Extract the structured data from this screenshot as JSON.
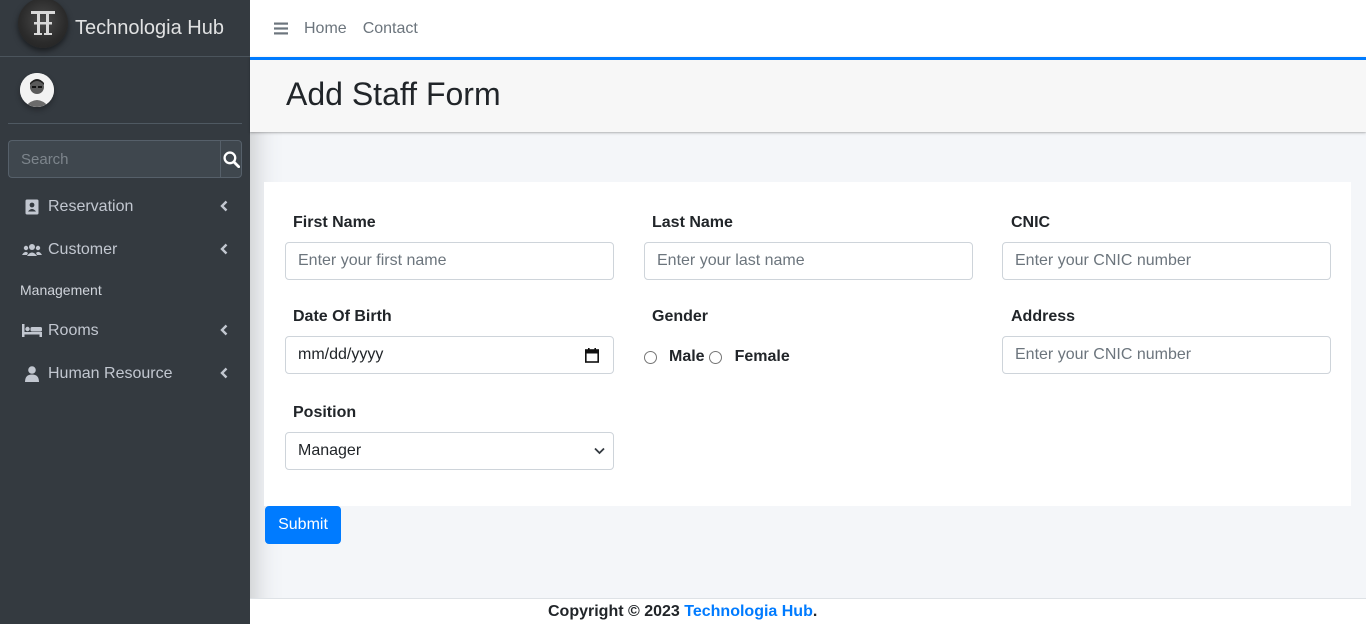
{
  "brand": {
    "name": "Technologia Hub",
    "logo_icon": "th-monogram-logo"
  },
  "user": {
    "avatar_icon": "user-avatar"
  },
  "sidebar": {
    "search_placeholder": "Search",
    "items": [
      {
        "label": "Reservation",
        "icon": "address-book-icon"
      },
      {
        "label": "Customer",
        "icon": "users-icon"
      }
    ],
    "header": "Management",
    "items2": [
      {
        "label": "Rooms",
        "icon": "bed-icon"
      },
      {
        "label": "Human Resource",
        "icon": "user-icon"
      }
    ]
  },
  "topbar": {
    "links": [
      "Home",
      "Contact"
    ]
  },
  "page": {
    "title": "Add Staff Form"
  },
  "form": {
    "first_name": {
      "label": "First Name",
      "placeholder": "Enter your first name"
    },
    "last_name": {
      "label": "Last Name",
      "placeholder": "Enter your last name"
    },
    "cnic": {
      "label": "CNIC",
      "placeholder": "Enter your CNIC number"
    },
    "dob": {
      "label": "Date Of Birth",
      "value": "mm/dd/yyyy"
    },
    "gender": {
      "label": "Gender",
      "options": [
        "Male",
        "Female"
      ]
    },
    "address": {
      "label": "Address",
      "placeholder": "Enter your CNIC number"
    },
    "position": {
      "label": "Position",
      "value": "Manager"
    },
    "submit": "Submit"
  },
  "footer": {
    "prefix": "Copyright © 2023 ",
    "link": "Technologia Hub",
    "suffix": "."
  },
  "colors": {
    "primary": "#007bff",
    "sidebar_bg": "#343a40",
    "content_bg": "#f4f6f9"
  }
}
